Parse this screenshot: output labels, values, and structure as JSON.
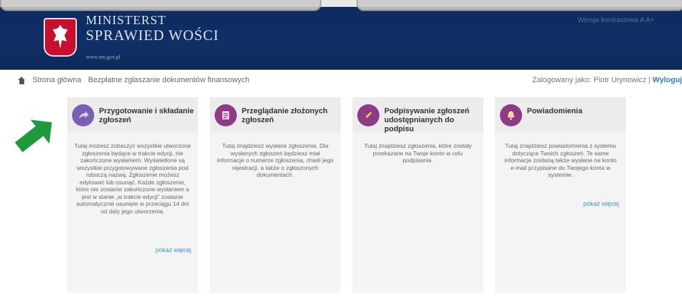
{
  "header": {
    "title_line1": "MINISTERST",
    "title_line2": "SPRAWIED  WOŚCI",
    "url": "www.ms.gov.pl",
    "version": "Wersja kontrastowa  A  A+"
  },
  "breadcrumb": {
    "home": "Strona główna",
    "current": "Bezpłatne zgłaszanie dokumentów finansowych"
  },
  "login": {
    "label": "Zalogowany jako: Piotr Urynowicz",
    "separator": "|",
    "logout": "Wyloguj"
  },
  "cards": [
    {
      "title": "Przygotowanie i składanie zgłoszeń",
      "body": "Tutaj możesz zobaczyć wszystkie utworzone zgłoszenia będące w trakcie edycji, nie zakończone wysłaniem. Wyświetlone są wszystkie przygotowywane zgłoszenia pod roboczą nazwą. Zgłoszenie możesz edytować lub usunąć. Każde zgłoszenie, które nie zostanie zakończone wysłaniem a jest w stanie „w trakcie edycji” zostanie automatycznie usunięte w przeciągu 14 dni od daty jego utworzenia.",
      "more": "pokaż więcej",
      "icon": "arrow-icon"
    },
    {
      "title": "Przeglądanie złożonych zgłoszeń",
      "body": "Tutaj znajdziesz wysłane zgłoszenia. Dla wysłanych zgłoszeń będziesz miał informacje o numerze zgłoszenia, chwili jego rejestracji, a także o zgłoszonych dokumentach.",
      "more": "",
      "icon": "document-icon"
    },
    {
      "title": "Podpisywanie zgłoszeń udostępnianych do podpisu",
      "body": "Tutaj znajdziesz zgłoszenia, które zostały przekazane na Twoje konto w celu podpisania.",
      "more": "",
      "icon": "pen-icon"
    },
    {
      "title": "Powiadomienia",
      "body": "Tutaj znajdziesz powiadomienia z systemu dotyczące Twoich zgłoszeń. Te same informacje zostaną także wysłane na konto e-mail przypisane do Twojego konta w systemie.",
      "more": "pokaż więcej",
      "icon": "bell-icon"
    }
  ],
  "colors": {
    "header_bg": "#0f2d63",
    "card_icon": "#8e3a87",
    "link": "#3b8fd6",
    "annotation_arrow": "#1e9a3c"
  }
}
